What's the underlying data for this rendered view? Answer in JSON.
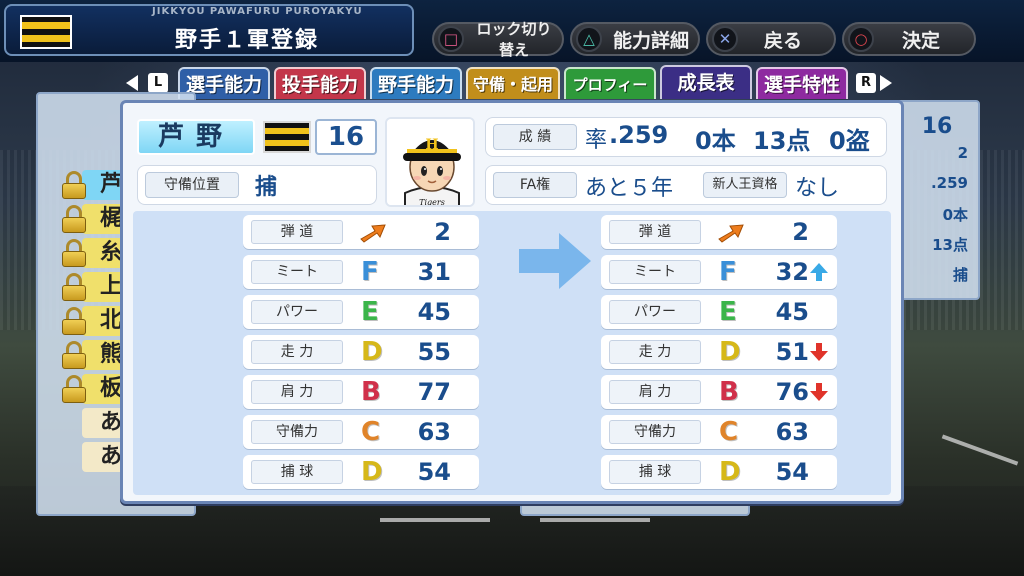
{
  "game_subtitle": "JIKKYOU PAWAFURU PUROYAKYU",
  "screen_title": "野手１軍登録",
  "buttons": [
    {
      "glyph": "□",
      "label": "ロック切り替え",
      "color": "#e05a8a"
    },
    {
      "glyph": "△",
      "label": "能力詳細",
      "color": "#4fc7b2"
    },
    {
      "glyph": "✕",
      "label": "戻る",
      "color": "#8aa5e8"
    },
    {
      "glyph": "○",
      "label": "決定",
      "color": "#e0464f"
    }
  ],
  "tabs": [
    {
      "label": "選手能力",
      "color": "#2f5fa7"
    },
    {
      "label": "投手能力",
      "color": "#c3364a"
    },
    {
      "label": "野手能力",
      "color": "#2d7bbf"
    },
    {
      "label": "守備・起用",
      "color": "#c18e1b"
    },
    {
      "label": "プロフィール",
      "color": "#2e9a3a"
    },
    {
      "label": "成長表",
      "color": "#3b2e85"
    },
    {
      "label": "選手特性",
      "color": "#8e2aa0"
    }
  ],
  "tab_keys": {
    "left": "L",
    "right": "R"
  },
  "player": {
    "name": "芦野",
    "number": "16",
    "position_label": "守備位置",
    "position": "捕",
    "cap_letter": "H",
    "jersey_text": "Tigers"
  },
  "record": {
    "label": "成 績",
    "avg_label": "率",
    "avg": ".259",
    "hr": "0本",
    "rbi": "13点",
    "sb": "0盗"
  },
  "fa": {
    "label": "FA権",
    "value": "あと５年",
    "rookie_label": "新人王資格",
    "rookie_value": "なし"
  },
  "stats_before": [
    {
      "label": "弾 道",
      "grade": "",
      "value": "2",
      "trajectory": true
    },
    {
      "label": "ミート",
      "grade": "F",
      "value": "31"
    },
    {
      "label": "パワー",
      "grade": "E",
      "value": "45"
    },
    {
      "label": "走 力",
      "grade": "D",
      "value": "55"
    },
    {
      "label": "肩 力",
      "grade": "B",
      "value": "77"
    },
    {
      "label": "守備力",
      "grade": "C",
      "value": "63"
    },
    {
      "label": "捕 球",
      "grade": "D",
      "value": "54"
    }
  ],
  "stats_after": [
    {
      "label": "弾 道",
      "grade": "",
      "value": "2",
      "trajectory": true,
      "change": ""
    },
    {
      "label": "ミート",
      "grade": "F",
      "value": "32",
      "change": "up"
    },
    {
      "label": "パワー",
      "grade": "E",
      "value": "45",
      "change": ""
    },
    {
      "label": "走 力",
      "grade": "D",
      "value": "51",
      "change": "down"
    },
    {
      "label": "肩 力",
      "grade": "B",
      "value": "76",
      "change": "down"
    },
    {
      "label": "守備力",
      "grade": "C",
      "value": "63",
      "change": ""
    },
    {
      "label": "捕 球",
      "grade": "D",
      "value": "54",
      "change": ""
    }
  ],
  "grade_colors": {
    "F": "#3a8fd8",
    "E": "#3bb54a",
    "D": "#d6b819",
    "C": "#e0842a",
    "B": "#d0304a"
  },
  "background_list": {
    "rows": [
      {
        "text": "芦",
        "color": "#7fd6f5",
        "locked": true
      },
      {
        "text": "梶",
        "color": "#f0e06b",
        "locked": true
      },
      {
        "text": "糸",
        "color": "#f0e06b",
        "locked": true
      },
      {
        "text": "上",
        "color": "#f0e06b",
        "locked": true
      },
      {
        "text": "北",
        "color": "#f0e06b",
        "locked": true
      },
      {
        "text": "熊",
        "color": "#f0e06b",
        "locked": true
      },
      {
        "text": "板",
        "color": "#f0e06b",
        "locked": true
      },
      {
        "text": "あ",
        "color": "#f3e9c8",
        "locked": false
      },
      {
        "text": "あ",
        "color": "#f3e9c8",
        "locked": false
      }
    ],
    "right_items": [
      "16",
      "2",
      ".259",
      "0本",
      "13点",
      "捕"
    ]
  }
}
